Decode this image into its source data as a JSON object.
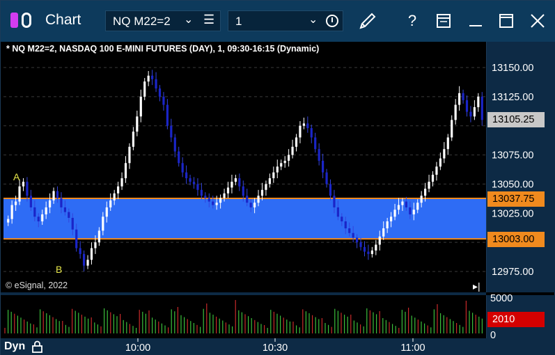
{
  "window": {
    "title": "Chart",
    "symbol": "NQ M22=2",
    "interval": "1",
    "icons": [
      "pencil-icon",
      "help-icon",
      "layout-icon",
      "minimize-icon",
      "maximize-icon",
      "close-icon"
    ]
  },
  "chart": {
    "info_line": "* NQ M22=2, NASDAQ 100 E-MINI FUTURES (DAY), 1, 09:30-16:15 (Dynamic)",
    "copyright": "© eSignal, 2022",
    "last_price": "13105.25",
    "zone_top": "13037.75",
    "zone_bottom": "13003.00",
    "volume_label": "2010",
    "dyn_label": "Dyn",
    "marker_a": "A",
    "marker_b": "B"
  },
  "colors": {
    "zone_fill": "#2e6cf5",
    "zone_border": "#f08a1e",
    "up_bar": "#ffffff",
    "down_bar": "#1a25c8",
    "vol_up": "#3bbf3b",
    "vol_down": "#c92a2a",
    "volume_tag": "#d40000",
    "last_tag": "#c8c8c8"
  },
  "chart_data": {
    "type": "candlestick",
    "y_ticks": [
      "13150.00",
      "13125.00",
      "13075.00",
      "13050.00",
      "13025.00",
      "12975.00"
    ],
    "volume_ticks": [
      "5000",
      "0"
    ],
    "x_ticks": [
      "10:00",
      "10:30",
      "11:00"
    ],
    "ylim": [
      12965,
      13165
    ],
    "zone": [
      13003.0,
      13037.75
    ],
    "close": [
      13020,
      13032,
      13035,
      13048,
      13052,
      13040,
      13030,
      13022,
      13018,
      13024,
      13030,
      13036,
      13044,
      13038,
      13030,
      13026,
      13021,
      13011,
      12995,
      12990,
      12980,
      12985,
      12995,
      13000,
      13010,
      13022,
      13030,
      13036,
      13042,
      13048,
      13055,
      13068,
      13082,
      13095,
      13108,
      13125,
      13138,
      13143,
      13140,
      13132,
      13125,
      13118,
      13100,
      13090,
      13078,
      13068,
      13060,
      13055,
      13052,
      13050,
      13045,
      13040,
      13038,
      13035,
      13032,
      13034,
      13038,
      13042,
      13047,
      13052,
      13055,
      13048,
      13040,
      13034,
      13030,
      13034,
      13040,
      13045,
      13050,
      13055,
      13060,
      13065,
      13068,
      13070,
      13075,
      13082,
      13090,
      13100,
      13102,
      13098,
      13090,
      13080,
      13070,
      13060,
      13050,
      13040,
      13030,
      13022,
      13018,
      13012,
      13008,
      13004,
      13000,
      12996,
      12992,
      12990,
      12993,
      12998,
      13005,
      13012,
      13018,
      13022,
      13028,
      13032,
      13035,
      13030,
      13024,
      13028,
      13034,
      13040,
      13046,
      13052,
      13058,
      13065,
      13072,
      13080,
      13090,
      13105,
      13118,
      13128,
      13122,
      13112,
      13108,
      13116,
      13125,
      13105
    ]
  }
}
